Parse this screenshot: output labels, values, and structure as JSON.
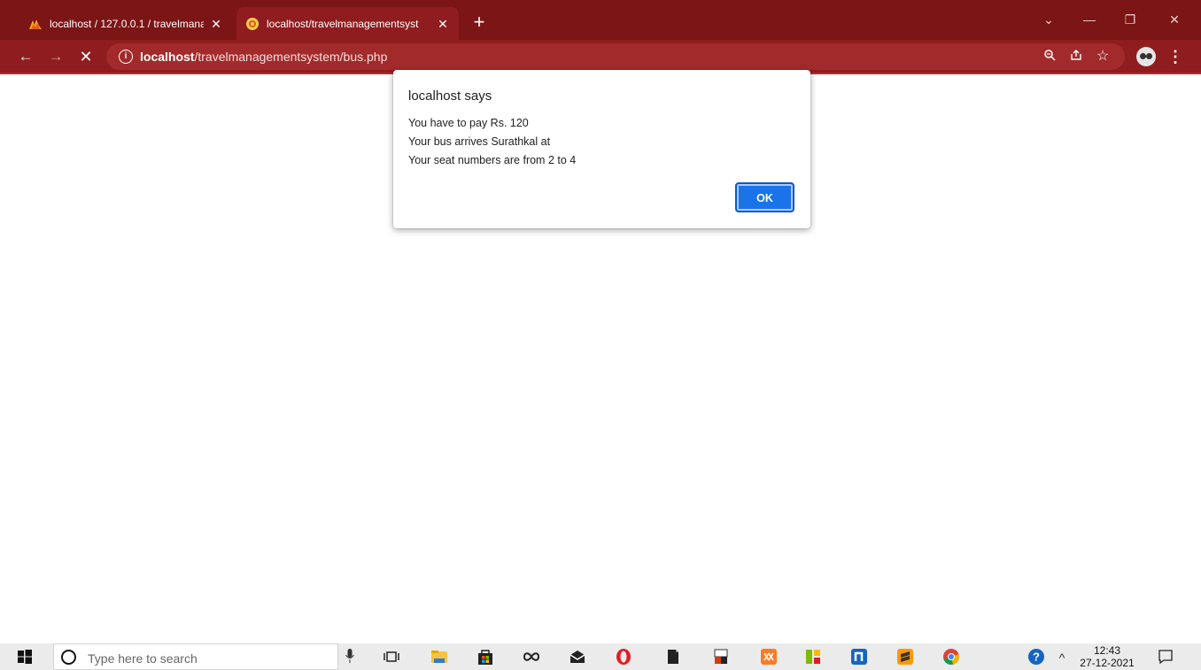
{
  "tabs": [
    {
      "title": "localhost / 127.0.0.1 / travelmana",
      "active": false
    },
    {
      "title": "localhost/travelmanagementsyst",
      "active": true
    }
  ],
  "address_bar": {
    "host": "localhost",
    "path": "/travelmanagementsystem/bus.php"
  },
  "dialog": {
    "title": "localhost says",
    "lines": [
      "You have to pay Rs. 120",
      "Your bus arrives Surathkal at",
      "Your seat numbers are from 2 to 4"
    ],
    "ok_label": "OK"
  },
  "taskbar": {
    "search_placeholder": "Type here to search",
    "time": "12:43",
    "date": "27-12-2021"
  },
  "colors": {
    "tabstrip": "#7b1516",
    "toolbar": "#8f1c1e",
    "ok_button": "#1a73e8"
  }
}
